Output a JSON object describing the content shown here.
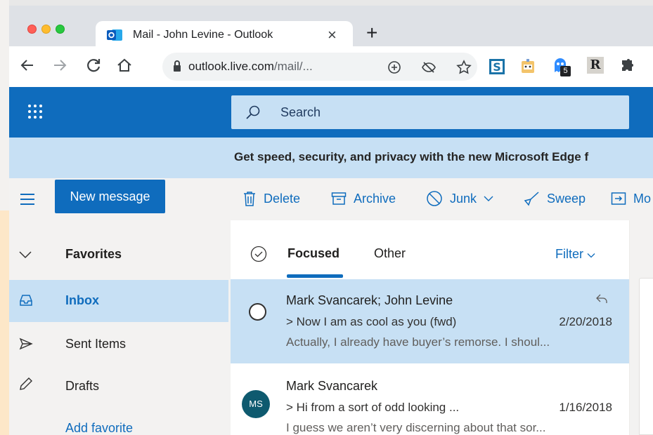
{
  "browser": {
    "tab_title": "Mail - John Levine - Outlook",
    "tab_close": "×",
    "new_tab": "+",
    "url_host": "outlook.live.com",
    "url_path": "/mail/...",
    "extension_badge": "5",
    "extension_r": "R"
  },
  "outlook": {
    "search_placeholder": "Search",
    "banner": "Get speed, security, and privacy with the new Microsoft Edge f",
    "new_message": "New message",
    "commands": {
      "delete": "Delete",
      "archive": "Archive",
      "junk": "Junk",
      "sweep": "Sweep",
      "move": "Mo"
    },
    "nav": {
      "favorites": "Favorites",
      "inbox": "Inbox",
      "sent": "Sent Items",
      "drafts": "Drafts",
      "add_favorite": "Add favorite"
    },
    "list": {
      "tab_focused": "Focused",
      "tab_other": "Other",
      "filter": "Filter"
    },
    "messages": [
      {
        "from": "Mark Svancarek; John Levine",
        "subject": "> Now I am as cool as you (fwd)",
        "date": "2/20/2018",
        "preview": "Actually, I already have buyer’s remorse. I shoul..."
      },
      {
        "avatar": "MS",
        "from": "Mark Svancarek",
        "subject": "> Hi from a sort of odd looking ...",
        "date": "1/16/2018",
        "preview": "I guess we aren’t very discerning about that sor..."
      }
    ],
    "colors": {
      "brand": "#0f6cbd",
      "selected": "#c7e0f4",
      "avatar": "#0e5a6f"
    }
  }
}
